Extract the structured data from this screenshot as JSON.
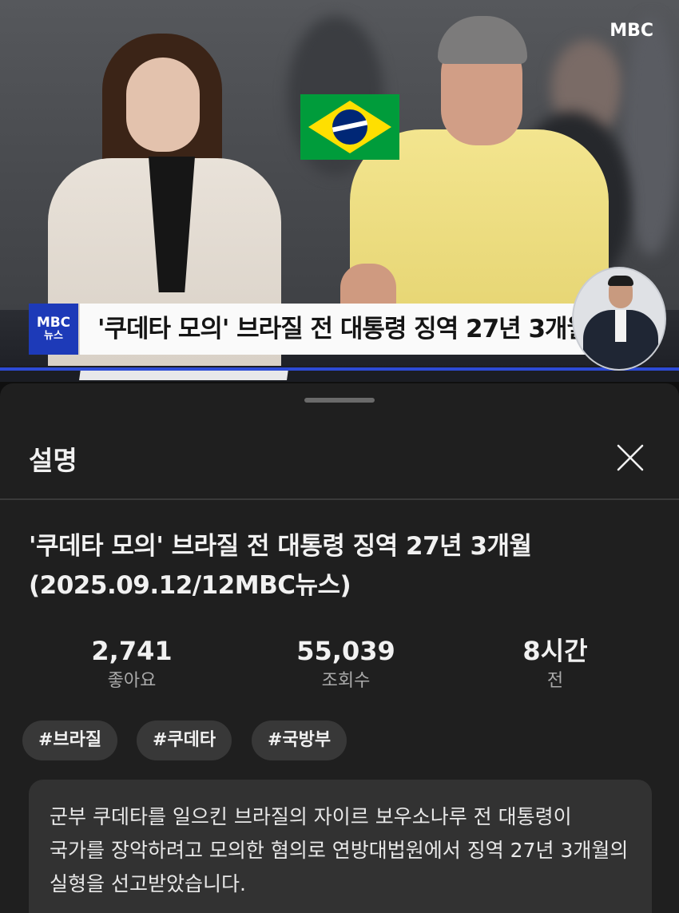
{
  "video": {
    "channel_logo": "MBC",
    "caption_logo_top": "MBC",
    "caption_logo_bottom": "뉴스",
    "caption": "'쿠데타 모의' 브라질 전 대통령 징역 27년 3개월"
  },
  "sheet": {
    "title": "설명",
    "close_icon": "close-icon",
    "video_title_line1": "'쿠데타 모의' 브라질 전 대통령 징역 27년 3개월",
    "video_title_line2": "(2025.09.12/12MBC뉴스)",
    "stats": [
      {
        "value": "2,741",
        "label": "좋아요"
      },
      {
        "value": "55,039",
        "label": "조회수"
      },
      {
        "value": "8시간",
        "label": "전"
      }
    ],
    "hashtags": [
      "#브라질",
      "#쿠데타",
      "#국방부"
    ],
    "description": "군부 쿠데타를 일으킨 브라질의 자이르 보우소나루 전 대통령이 국가를 장악하려고 모의한 혐의로 연방대법원에서 징역 27년 3개월의 실형을 선고받았습니다."
  },
  "colors": {
    "background": "#0f0f0f",
    "sheet": "#1f1f1f",
    "chip": "#383838",
    "description_box": "#323232",
    "mbc_blue": "#1d3ab8"
  }
}
